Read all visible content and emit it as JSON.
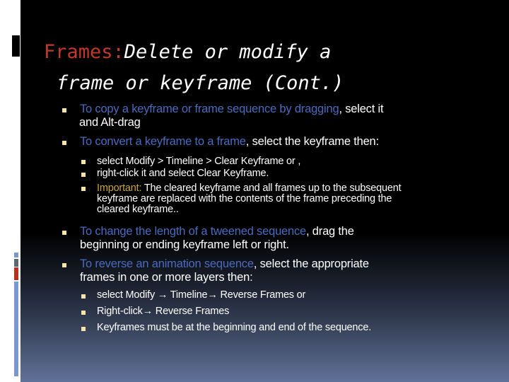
{
  "slide": {
    "title_lead": "Frames:",
    "title_rest": "Delete or modify a",
    "title_line2": "frame or keyframe (Cont.)",
    "bullets": [
      {
        "highlight": " To copy a keyframe or frame sequence by dragging",
        "rest": ", select it",
        "line2": "and Alt-drag"
      },
      {
        "highlight": "To convert a keyframe to a frame",
        "rest": ", select the keyframe then:"
      },
      {
        "highlight": "To change the length of a tweened sequence",
        "rest": ", drag the",
        "line2": "beginning or ending keyframe left or right."
      },
      {
        "highlight": "To reverse an animation sequence",
        "rest": ", select the appropriate",
        "line2": "frames in one or more layers then:"
      }
    ],
    "sub_bullets_convert": [
      " select Modify > Timeline > Clear Keyframe or ,",
      "right-click it and select Clear Keyframe.",
      {
        "label": "Important:",
        "text": " The cleared keyframe and all frames up to the subsequent",
        "line2": "keyframe are replaced with the contents of the frame preceding the",
        "line3": "cleared keyframe.."
      }
    ],
    "sub_bullets_reverse": [
      " select Modify → Timeline→ Reverse Frames or",
      "Right-click→ Reverse Frames",
      " Keyframes must be at the beginning and end of the sequence."
    ]
  },
  "colors": {
    "title_accent": "#c0392b",
    "highlight_blue": "#4a6bbf",
    "important_gold": "#c9a53a",
    "bullet_yellow": "#f5e6a8"
  }
}
